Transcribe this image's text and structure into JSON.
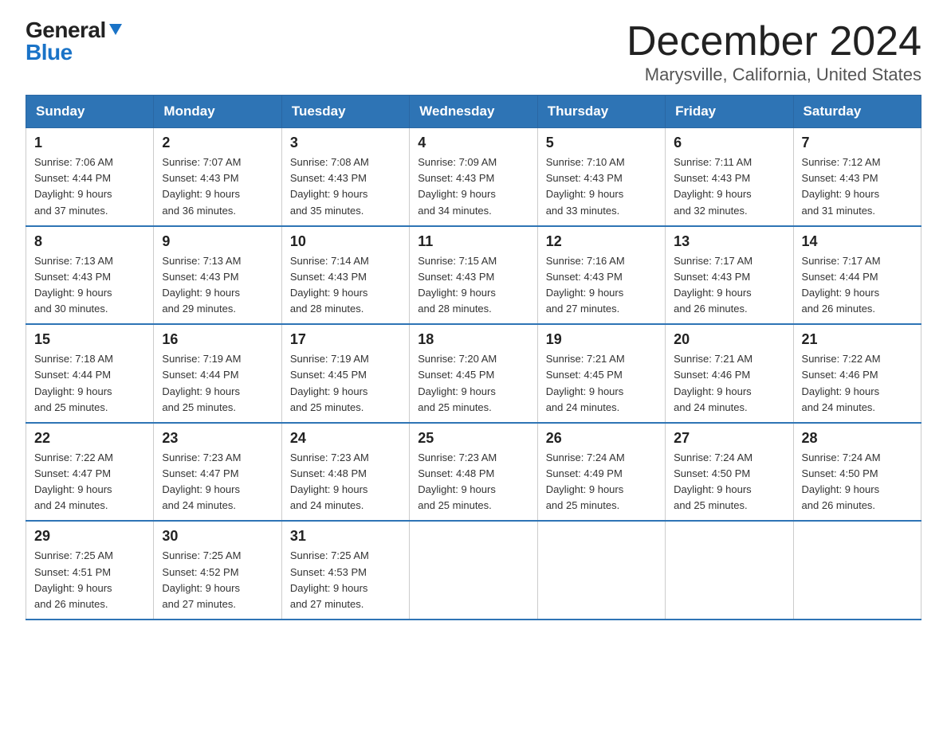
{
  "header": {
    "logo_general": "General",
    "logo_blue": "Blue",
    "month_title": "December 2024",
    "location": "Marysville, California, United States"
  },
  "weekdays": [
    "Sunday",
    "Monday",
    "Tuesday",
    "Wednesday",
    "Thursday",
    "Friday",
    "Saturday"
  ],
  "weeks": [
    [
      {
        "day": "1",
        "sunrise": "7:06 AM",
        "sunset": "4:44 PM",
        "daylight": "9 hours and 37 minutes."
      },
      {
        "day": "2",
        "sunrise": "7:07 AM",
        "sunset": "4:43 PM",
        "daylight": "9 hours and 36 minutes."
      },
      {
        "day": "3",
        "sunrise": "7:08 AM",
        "sunset": "4:43 PM",
        "daylight": "9 hours and 35 minutes."
      },
      {
        "day": "4",
        "sunrise": "7:09 AM",
        "sunset": "4:43 PM",
        "daylight": "9 hours and 34 minutes."
      },
      {
        "day": "5",
        "sunrise": "7:10 AM",
        "sunset": "4:43 PM",
        "daylight": "9 hours and 33 minutes."
      },
      {
        "day": "6",
        "sunrise": "7:11 AM",
        "sunset": "4:43 PM",
        "daylight": "9 hours and 32 minutes."
      },
      {
        "day": "7",
        "sunrise": "7:12 AM",
        "sunset": "4:43 PM",
        "daylight": "9 hours and 31 minutes."
      }
    ],
    [
      {
        "day": "8",
        "sunrise": "7:13 AM",
        "sunset": "4:43 PM",
        "daylight": "9 hours and 30 minutes."
      },
      {
        "day": "9",
        "sunrise": "7:13 AM",
        "sunset": "4:43 PM",
        "daylight": "9 hours and 29 minutes."
      },
      {
        "day": "10",
        "sunrise": "7:14 AM",
        "sunset": "4:43 PM",
        "daylight": "9 hours and 28 minutes."
      },
      {
        "day": "11",
        "sunrise": "7:15 AM",
        "sunset": "4:43 PM",
        "daylight": "9 hours and 28 minutes."
      },
      {
        "day": "12",
        "sunrise": "7:16 AM",
        "sunset": "4:43 PM",
        "daylight": "9 hours and 27 minutes."
      },
      {
        "day": "13",
        "sunrise": "7:17 AM",
        "sunset": "4:43 PM",
        "daylight": "9 hours and 26 minutes."
      },
      {
        "day": "14",
        "sunrise": "7:17 AM",
        "sunset": "4:44 PM",
        "daylight": "9 hours and 26 minutes."
      }
    ],
    [
      {
        "day": "15",
        "sunrise": "7:18 AM",
        "sunset": "4:44 PM",
        "daylight": "9 hours and 25 minutes."
      },
      {
        "day": "16",
        "sunrise": "7:19 AM",
        "sunset": "4:44 PM",
        "daylight": "9 hours and 25 minutes."
      },
      {
        "day": "17",
        "sunrise": "7:19 AM",
        "sunset": "4:45 PM",
        "daylight": "9 hours and 25 minutes."
      },
      {
        "day": "18",
        "sunrise": "7:20 AM",
        "sunset": "4:45 PM",
        "daylight": "9 hours and 25 minutes."
      },
      {
        "day": "19",
        "sunrise": "7:21 AM",
        "sunset": "4:45 PM",
        "daylight": "9 hours and 24 minutes."
      },
      {
        "day": "20",
        "sunrise": "7:21 AM",
        "sunset": "4:46 PM",
        "daylight": "9 hours and 24 minutes."
      },
      {
        "day": "21",
        "sunrise": "7:22 AM",
        "sunset": "4:46 PM",
        "daylight": "9 hours and 24 minutes."
      }
    ],
    [
      {
        "day": "22",
        "sunrise": "7:22 AM",
        "sunset": "4:47 PM",
        "daylight": "9 hours and 24 minutes."
      },
      {
        "day": "23",
        "sunrise": "7:23 AM",
        "sunset": "4:47 PM",
        "daylight": "9 hours and 24 minutes."
      },
      {
        "day": "24",
        "sunrise": "7:23 AM",
        "sunset": "4:48 PM",
        "daylight": "9 hours and 24 minutes."
      },
      {
        "day": "25",
        "sunrise": "7:23 AM",
        "sunset": "4:48 PM",
        "daylight": "9 hours and 25 minutes."
      },
      {
        "day": "26",
        "sunrise": "7:24 AM",
        "sunset": "4:49 PM",
        "daylight": "9 hours and 25 minutes."
      },
      {
        "day": "27",
        "sunrise": "7:24 AM",
        "sunset": "4:50 PM",
        "daylight": "9 hours and 25 minutes."
      },
      {
        "day": "28",
        "sunrise": "7:24 AM",
        "sunset": "4:50 PM",
        "daylight": "9 hours and 26 minutes."
      }
    ],
    [
      {
        "day": "29",
        "sunrise": "7:25 AM",
        "sunset": "4:51 PM",
        "daylight": "9 hours and 26 minutes."
      },
      {
        "day": "30",
        "sunrise": "7:25 AM",
        "sunset": "4:52 PM",
        "daylight": "9 hours and 27 minutes."
      },
      {
        "day": "31",
        "sunrise": "7:25 AM",
        "sunset": "4:53 PM",
        "daylight": "9 hours and 27 minutes."
      },
      null,
      null,
      null,
      null
    ]
  ],
  "labels": {
    "sunrise": "Sunrise:",
    "sunset": "Sunset:",
    "daylight": "Daylight:"
  }
}
